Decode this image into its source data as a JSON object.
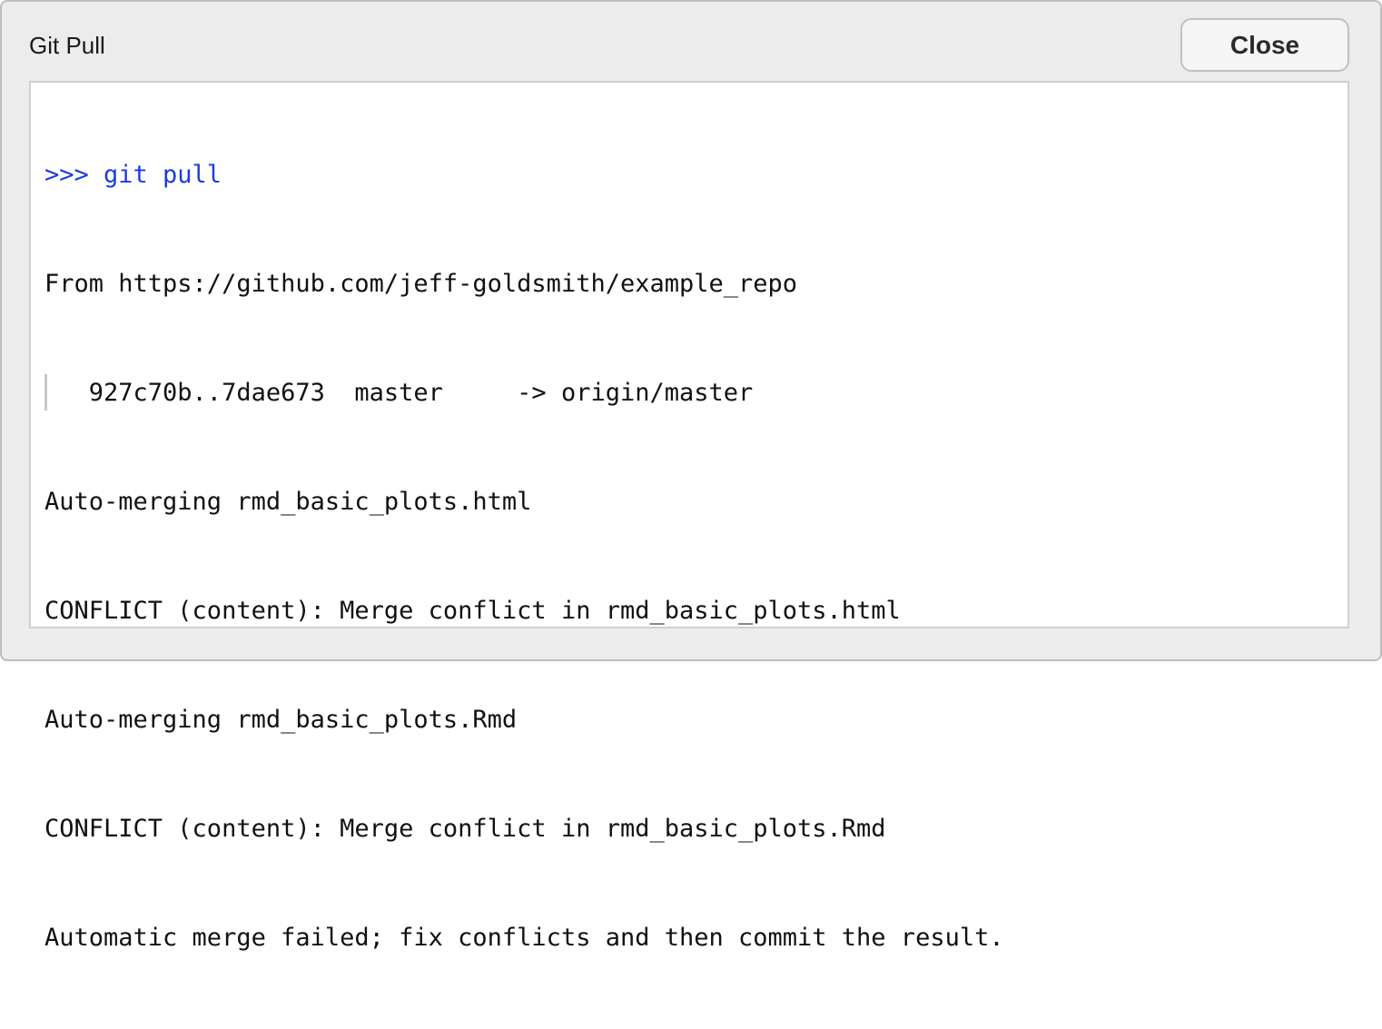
{
  "dialog": {
    "title": "Git Pull",
    "close_label": "Close"
  },
  "console": {
    "command": ">>> git pull",
    "output_lines": [
      "From https://github.com/jeff-goldsmith/example_repo",
      "   927c70b..7dae673  master     -> origin/master",
      "Auto-merging rmd_basic_plots.html",
      "CONFLICT (content): Merge conflict in rmd_basic_plots.html",
      "Auto-merging rmd_basic_plots.Rmd",
      "CONFLICT (content): Merge conflict in rmd_basic_plots.Rmd",
      "Automatic merge failed; fix conflicts and then commit the result."
    ]
  },
  "colors": {
    "command": "#1a3ce0",
    "output": "#111111",
    "dialog_background": "#ececec"
  }
}
